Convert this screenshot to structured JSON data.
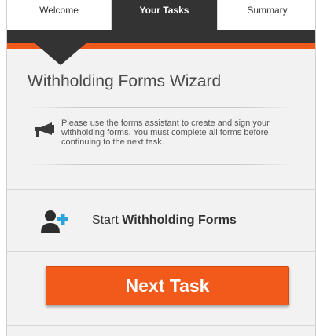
{
  "tabs": [
    {
      "label": "Welcome"
    },
    {
      "label": "Your Tasks"
    },
    {
      "label": "Summary"
    }
  ],
  "active_tab": "Your Tasks",
  "page": {
    "title": "Withholding Forms Wizard",
    "notice": "Please use the forms assistant to create and sign your withholding forms. You must complete all forms before continuing to the next task."
  },
  "task": {
    "prefix": "Start",
    "name": "Withholding Forms",
    "icon": "user-add-icon"
  },
  "next_button": {
    "label": "Next Task"
  },
  "colors": {
    "accent": "#f25a1c",
    "dark": "#333333",
    "add_icon": "#2ba3dd"
  }
}
